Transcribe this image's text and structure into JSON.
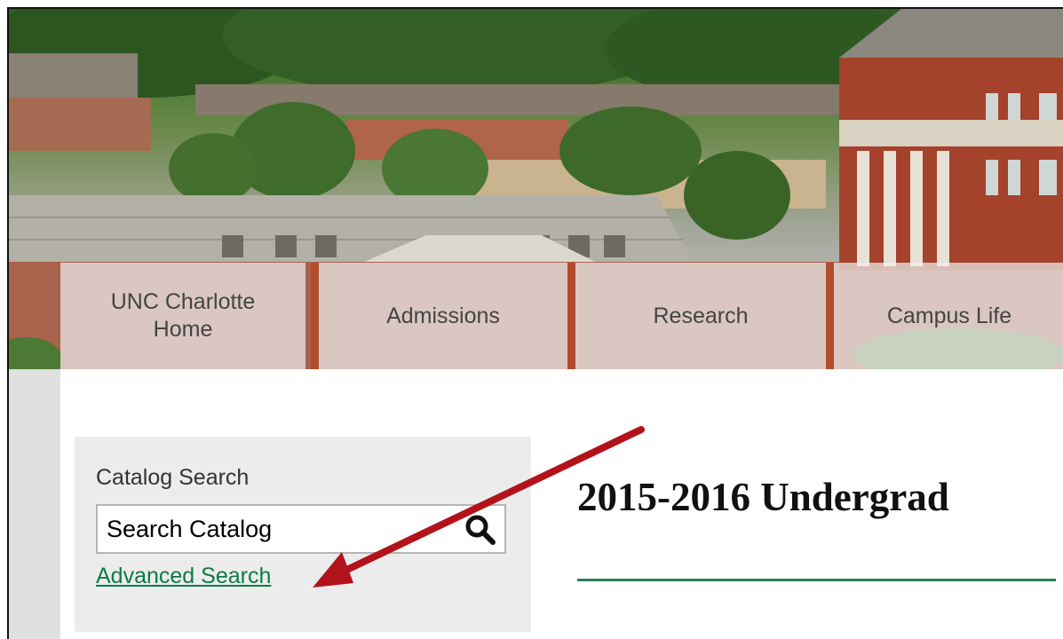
{
  "nav": {
    "items": [
      {
        "label": "UNC Charlotte\nHome"
      },
      {
        "label": "Admissions"
      },
      {
        "label": "Research"
      },
      {
        "label": "Campus Life"
      }
    ]
  },
  "search": {
    "title": "Catalog Search",
    "placeholder": "Search Catalog",
    "advanced_label": "Advanced Search"
  },
  "main": {
    "title": "2015-2016 Undergrad"
  },
  "colors": {
    "link": "#0c7a48",
    "rule": "#2f7d55",
    "annotation_arrow": "#b3121b",
    "nav_divider": "#b14a2a"
  }
}
